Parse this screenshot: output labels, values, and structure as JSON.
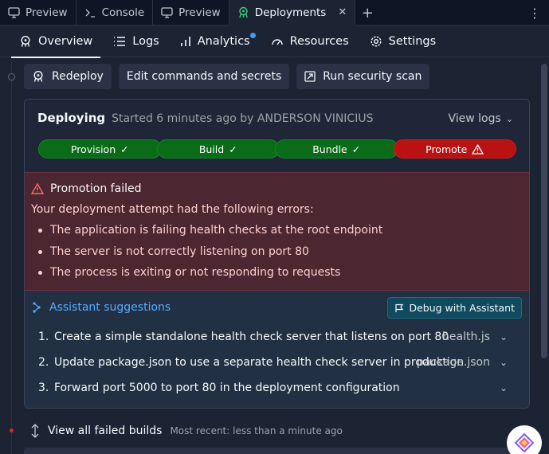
{
  "tabs": [
    {
      "label": "Preview",
      "icon": "monitor-icon"
    },
    {
      "label": "Console",
      "icon": "terminal-icon"
    },
    {
      "label": "Preview",
      "icon": "monitor-icon"
    },
    {
      "label": "Deployments",
      "icon": "deployments-icon",
      "active": true
    }
  ],
  "nav": {
    "items": [
      {
        "label": "Overview",
        "icon": "deploy-icon",
        "active": true
      },
      {
        "label": "Logs",
        "icon": "list-icon"
      },
      {
        "label": "Analytics",
        "icon": "bar-chart-icon",
        "badge": true
      },
      {
        "label": "Resources",
        "icon": "gauge-icon"
      },
      {
        "label": "Settings",
        "icon": "gear-icon"
      }
    ]
  },
  "actions": {
    "redeploy": "Redeploy",
    "edit": "Edit commands and secrets",
    "scan": "Run security scan"
  },
  "deployment": {
    "title": "Deploying",
    "started": "Started 6 minutes ago by ANDERSON VINICIUS",
    "view_logs": "View logs",
    "stages": [
      {
        "label": "Provision",
        "status": "ok"
      },
      {
        "label": "Build",
        "status": "ok"
      },
      {
        "label": "Bundle",
        "status": "ok"
      },
      {
        "label": "Promote",
        "status": "failed"
      }
    ]
  },
  "error": {
    "title": "Promotion failed",
    "intro": "Your deployment attempt had the following errors:",
    "items": [
      "The application is failing health checks at the root endpoint",
      "The server is not correctly listening on port 80",
      "The process is exiting or not responding to requests"
    ]
  },
  "assistant": {
    "title": "Assistant suggestions",
    "debug_button": "Debug with Assistant",
    "suggestions": [
      {
        "num": "1.",
        "text": "Create a simple standalone health check server that listens on port 80",
        "file": "health.js"
      },
      {
        "num": "2.",
        "text": "Update package.json to use a separate health check server in production",
        "file": "package.json"
      },
      {
        "num": "3.",
        "text": "Forward port 5000 to port 80 in the deployment configuration",
        "file": ""
      }
    ]
  },
  "failed_builds": {
    "label": "View all failed builds",
    "meta": "Most recent: less than a minute ago"
  },
  "colors": {
    "background": "#1c2333",
    "success": "#0a6b18",
    "failure": "#b81212",
    "accent": "#57abff"
  }
}
